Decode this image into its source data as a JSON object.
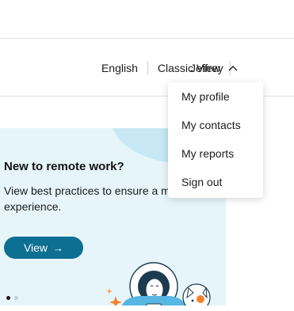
{
  "header": {
    "language": "English",
    "view_mode": "Classic View",
    "user_name": "Jeffrey"
  },
  "user_menu": {
    "items": [
      {
        "label": "My profile"
      },
      {
        "label": "My contacts"
      },
      {
        "label": "My reports"
      },
      {
        "label": "Sign out"
      }
    ]
  },
  "banner": {
    "title": "New to remote work?",
    "description": "View best practices to ensure a meeting experience.",
    "button_label": "View",
    "button_arrow": "→",
    "carousel": {
      "current": 1,
      "total": 2
    }
  },
  "colors": {
    "accent": "#0d6f91",
    "banner_bg": "#e6f5fa",
    "spark": "#f5822b"
  },
  "icons": {
    "user_menu_chevron": "chevron-up-icon",
    "button_arrow": "arrow-right-icon"
  }
}
